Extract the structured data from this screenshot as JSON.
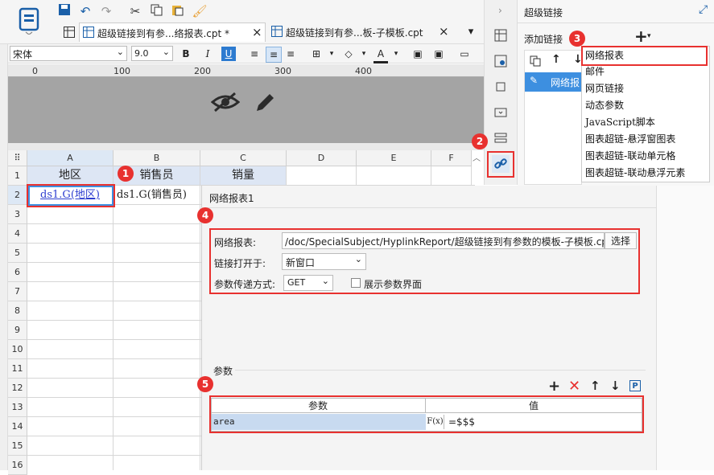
{
  "toolbar": {
    "icons": [
      "save-icon",
      "undo-icon",
      "redo-icon",
      "cut-icon",
      "copy-icon",
      "paste-icon",
      "format-brush-icon"
    ]
  },
  "tabs": [
    {
      "label": "超级链接到有参...络报表.cpt *",
      "close": "×"
    },
    {
      "label": "超级链接到有参...板-子模板.cpt",
      "close": "×"
    }
  ],
  "format": {
    "font": "宋体",
    "size": "9.0",
    "bold": "B",
    "italic": "I",
    "underline": "U"
  },
  "ruler": {
    "marks": [
      "0",
      "100",
      "200",
      "300",
      "400"
    ]
  },
  "grid": {
    "columns": [
      "A",
      "B",
      "C",
      "D",
      "E",
      "F"
    ],
    "rows": [
      "1",
      "2",
      "3",
      "4",
      "5",
      "6",
      "7",
      "8",
      "9",
      "10",
      "11",
      "12",
      "13",
      "14",
      "15",
      "16"
    ],
    "row1": {
      "a": "地区",
      "b": "销售员",
      "c": "销量"
    },
    "row2": {
      "a": "ds1.G(地区)",
      "b": "ds1.G(销售员)"
    }
  },
  "panel": {
    "title": "超级链接",
    "add_label": "添加链接",
    "add_symbol": "+",
    "list_item": "网络报",
    "menu": [
      "网络报表",
      "邮件",
      "网页链接",
      "动态参数",
      "JavaScript脚本",
      "图表超链-悬浮窗图表",
      "图表超链-联动单元格",
      "图表超链-联动悬浮元素"
    ]
  },
  "dialog": {
    "title": "网络报表1",
    "report_label": "网络报表:",
    "report_path": "/doc/SpecialSubject/HyplinkReport/超级链接到有参数的模板-子模板.cpt",
    "choose_button": "选择",
    "open_label": "链接打开于:",
    "open_value": "新窗口",
    "method_label": "参数传递方式:",
    "method_value": "GET",
    "show_params_label": "展示参数界面",
    "params_section": "参数",
    "param_col_name": "参数",
    "param_col_value": "值",
    "param_row": {
      "name": "area",
      "fx": "F(x)",
      "value": "=$$$"
    }
  },
  "badges": [
    "1",
    "2",
    "3",
    "4",
    "5"
  ],
  "colors": {
    "accent": "#1a5fa8",
    "highlight": "#e8312f",
    "selection": "#3d8fe0"
  }
}
